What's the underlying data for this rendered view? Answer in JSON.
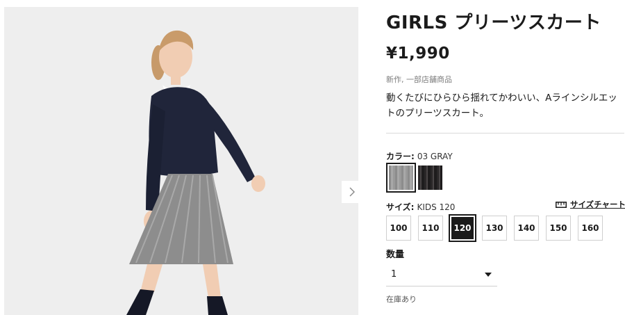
{
  "product": {
    "title": "GIRLS プリーツスカート",
    "price": "¥1,990",
    "tags": "新作, 一部店舗商品",
    "description": "動くたびにひらひら揺れてかわいい、Aラインシルエットのプリーツスカート。"
  },
  "color": {
    "label": "カラー:",
    "selected": "03 GRAY",
    "swatches": [
      {
        "name": "gray",
        "hex": "#9a9a9a"
      },
      {
        "name": "black",
        "hex": "#2a2728"
      }
    ]
  },
  "size": {
    "label": "サイズ:",
    "selected": "KIDS 120",
    "chart_link": "サイズチャート",
    "options": [
      "100",
      "110",
      "120",
      "130",
      "140",
      "150",
      "160"
    ],
    "selected_option": "120"
  },
  "quantity": {
    "label": "数量",
    "value": "1"
  },
  "stock_status": "在庫あり",
  "colors": {
    "text": "#1b1b1b",
    "image_bg": "#eeeeee",
    "muted": "#7d7d7d",
    "border": "#cfcfcf"
  },
  "icons": {
    "carousel_next": "chevron-right-icon",
    "size_chart": "ruler-icon",
    "dropdown": "caret-down-icon"
  }
}
